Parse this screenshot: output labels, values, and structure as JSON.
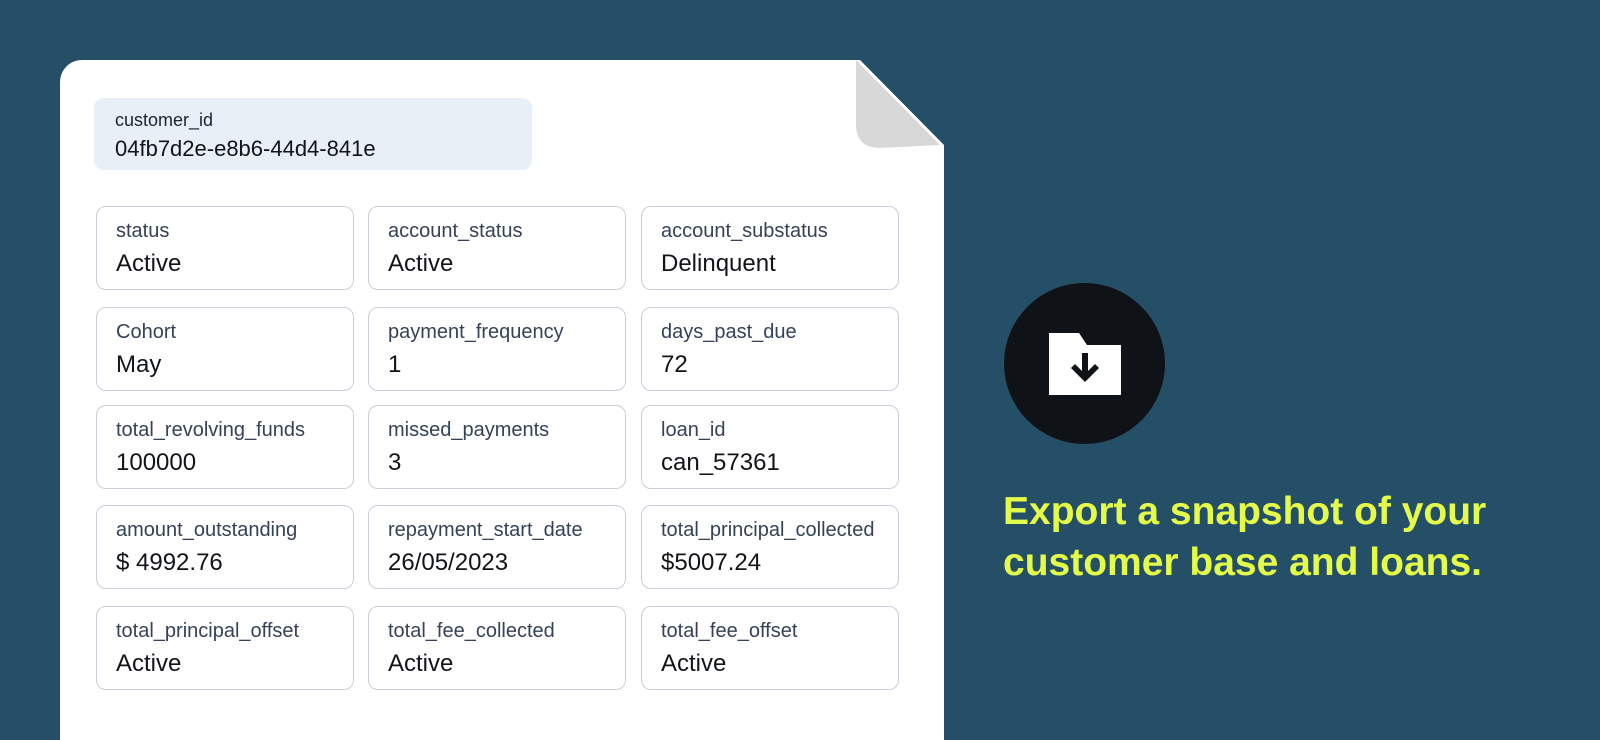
{
  "customer": {
    "id_label": "customer_id",
    "id_value": "04fb7d2e-e8b6-44d4-841e"
  },
  "fields": [
    {
      "label": "status",
      "value": "Active"
    },
    {
      "label": "account_status",
      "value": "Active"
    },
    {
      "label": "account_substatus",
      "value": "Delinquent"
    },
    {
      "label": "Cohort",
      "value": "May"
    },
    {
      "label": "payment_frequency",
      "value": "1"
    },
    {
      "label": "days_past_due",
      "value": "72"
    },
    {
      "label": "total_revolving_funds",
      "value": "100000"
    },
    {
      "label": "missed_payments",
      "value": "3"
    },
    {
      "label": "loan_id",
      "value": "can_57361"
    },
    {
      "label": "amount_outstanding",
      "value": "$ 4992.76"
    },
    {
      "label": "repayment_start_date",
      "value": "26/05/2023"
    },
    {
      "label": "total_principal_collected",
      "value": "$5007.24"
    },
    {
      "label": "total_principal_offset",
      "value": "Active"
    },
    {
      "label": "total_fee_collected",
      "value": "Active"
    },
    {
      "label": "total_fee_offset",
      "value": "Active"
    }
  ],
  "promo": {
    "icon": "folder-download-icon",
    "line1": "Export a snapshot of your",
    "line2": "customer base and loans."
  },
  "colors": {
    "background": "#254f66",
    "accent": "#e5fb49",
    "icon_circle": "#0f1216",
    "id_chip": "#e8eff7"
  }
}
